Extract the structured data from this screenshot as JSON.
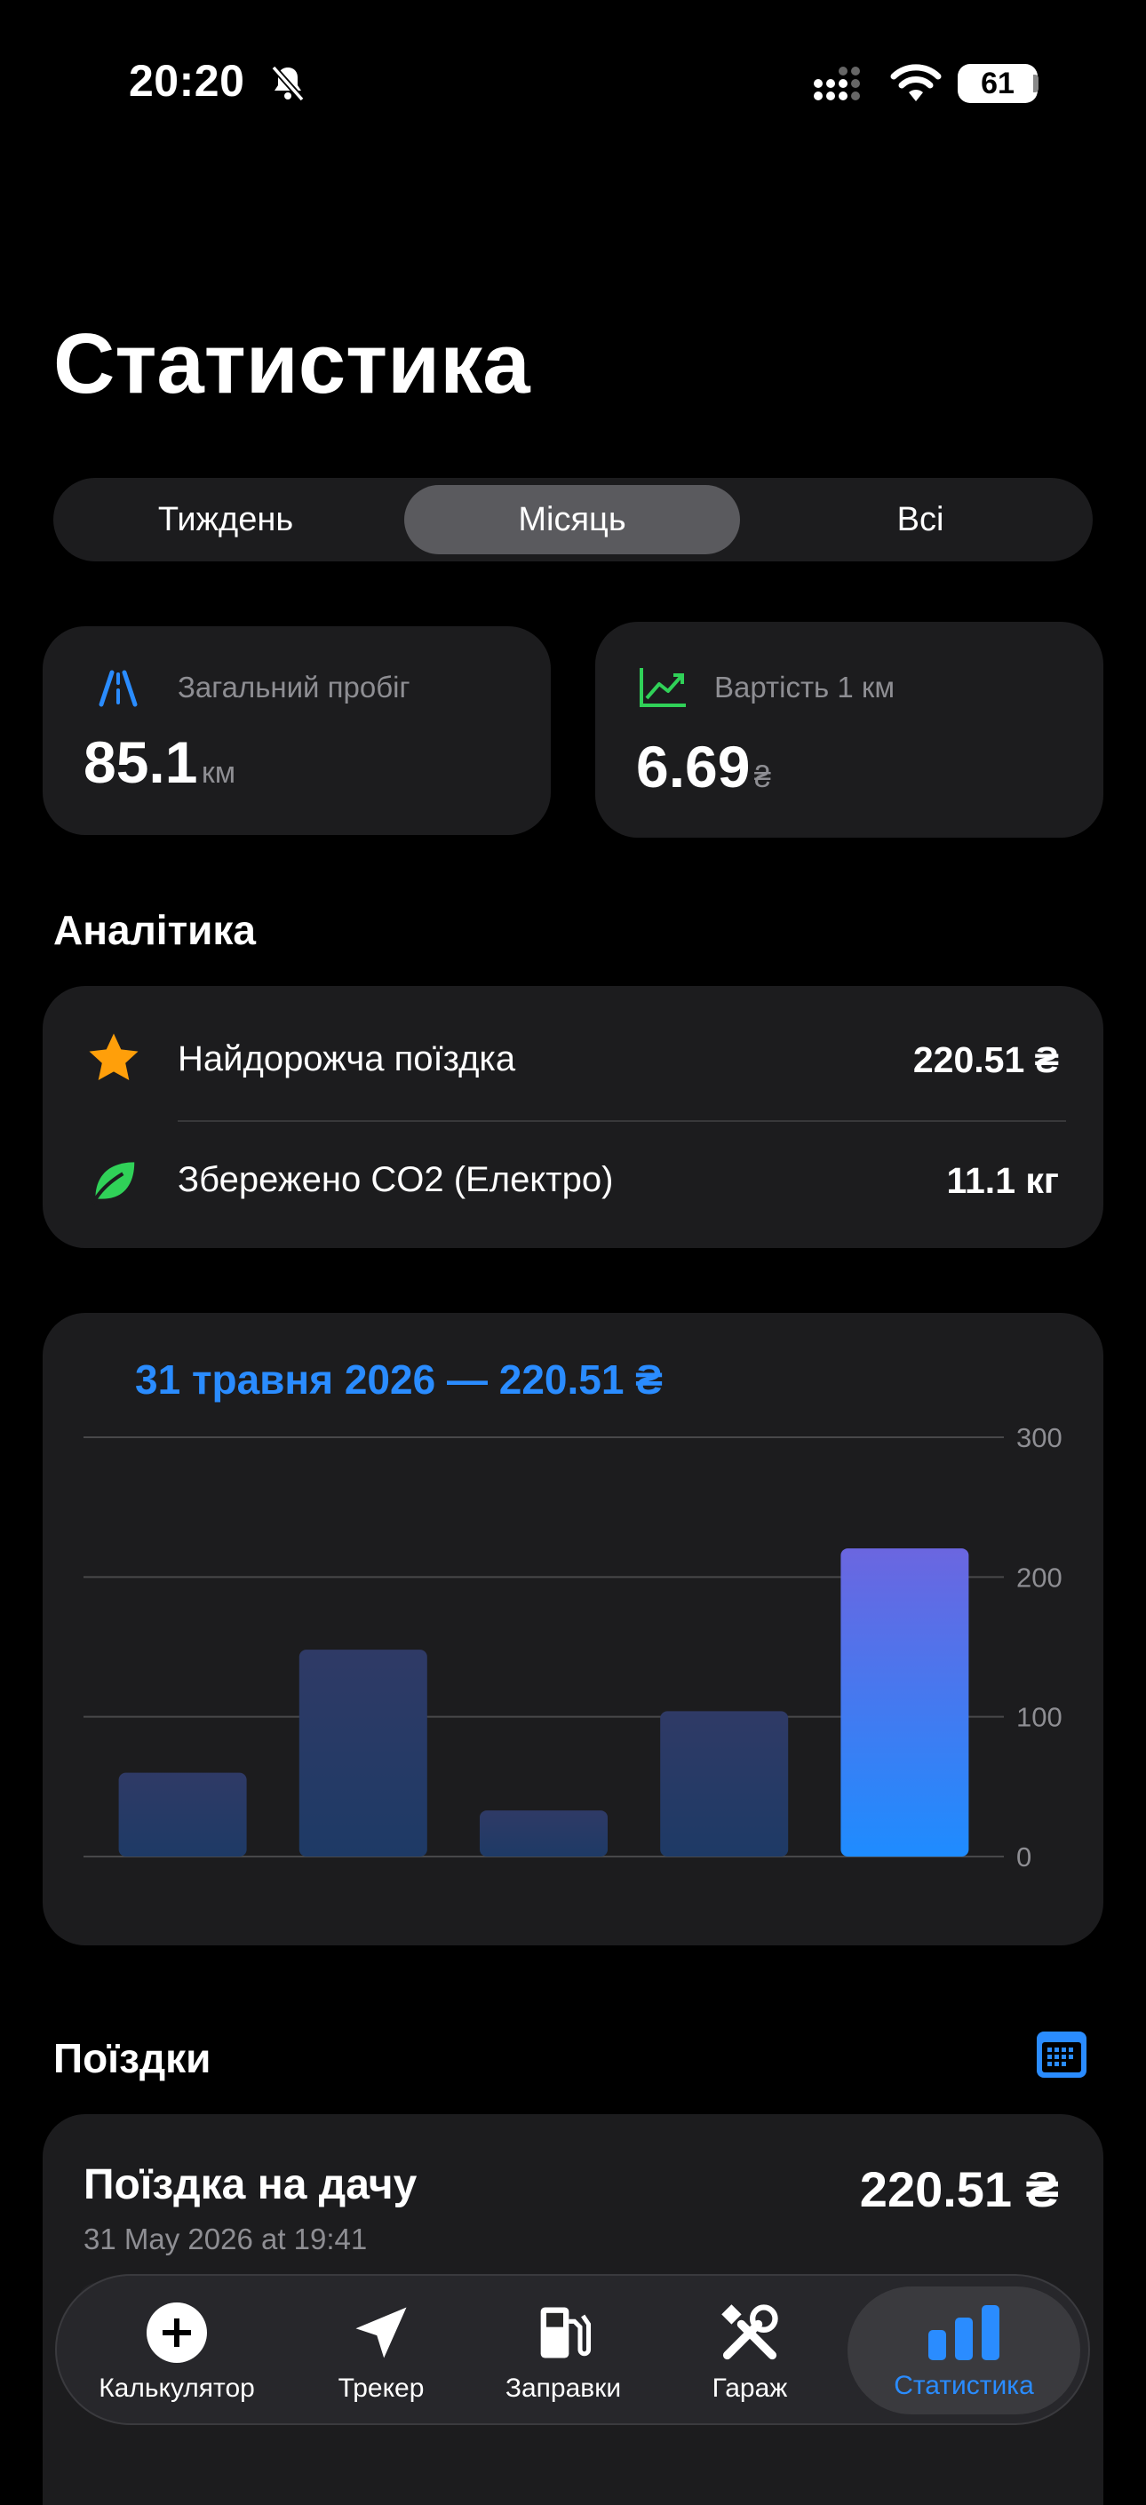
{
  "status": {
    "time": "20:20",
    "battery": "61"
  },
  "page_title": "Статистика",
  "segments": [
    {
      "label": "Тиждень"
    },
    {
      "label": "Місяць"
    },
    {
      "label": "Всі"
    }
  ],
  "stats": {
    "mileage": {
      "label": "Загальний пробіг",
      "value": "85.1",
      "unit": "км",
      "icon": "road-icon"
    },
    "cost_km": {
      "label": "Вартість 1 км",
      "value": "6.69",
      "unit": "₴",
      "icon": "trend-up-icon"
    }
  },
  "analytics": {
    "heading": "Аналітика",
    "rows": [
      {
        "label": "Найдорожча поїздка",
        "value": "220.51 ₴",
        "icon": "star-icon"
      },
      {
        "label": "Збережено CO2 (Електро)",
        "value": "11.1 кг",
        "icon": "leaf-icon"
      }
    ]
  },
  "chart_data": {
    "type": "bar",
    "title": "31 травня 2026 — 220.51 ₴",
    "values": [
      60,
      148,
      33,
      104,
      220.51
    ],
    "ylim": [
      0,
      300
    ],
    "yticks": [
      "300",
      "200",
      "100",
      "0"
    ],
    "grid": true,
    "colors": {
      "inactive": "#2f3a66",
      "active_top": "#6b66e0",
      "active_bottom": "#1e8cff"
    },
    "active_index": 4
  },
  "trips": {
    "heading": "Поїздки",
    "items": [
      {
        "title": "Поїздка на дачу",
        "amount": "220.51 ₴",
        "datetime": "31 May 2026 at 19:41"
      }
    ]
  },
  "tabs": [
    {
      "label": "Калькулятор",
      "icon": "plus-circle-icon"
    },
    {
      "label": "Трекер",
      "icon": "location-arrow-icon"
    },
    {
      "label": "Заправки",
      "icon": "fuel-pump-icon"
    },
    {
      "label": "Гараж",
      "icon": "tools-icon"
    },
    {
      "label": "Статистика",
      "icon": "bar-chart-icon"
    }
  ],
  "colors": {
    "accent": "#2a8cff",
    "card": "#1c1c1e",
    "star": "#ff9f0a",
    "leaf": "#30d158",
    "trend": "#30d158"
  }
}
